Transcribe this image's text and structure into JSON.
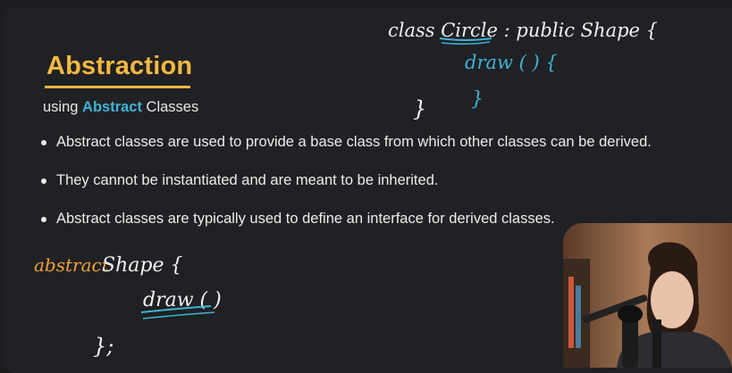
{
  "slide": {
    "title": "Abstraction",
    "subtitle_prefix": "using ",
    "subtitle_accent": "Abstract",
    "subtitle_suffix": " Classes",
    "bullets": [
      "Abstract classes are used to provide a base class from which other classes can be derived.",
      "They cannot be instantiated and are meant to be inherited.",
      "Abstract classes are typically used to define an interface for derived classes."
    ]
  },
  "annotations": {
    "top_line1": "class Circle : public Shape {",
    "top_line2": "draw ( ) {",
    "top_brace_inner": "}",
    "top_brace_outer": "}",
    "bottom_keyword": "abstract",
    "bottom_class": "Shape {",
    "bottom_method": "draw ( )",
    "bottom_close": "};"
  },
  "colors": {
    "title": "#f4b942",
    "accent": "#3fb3d8",
    "ink_white": "#f2f2f2",
    "ink_orange": "#f0a23a",
    "ink_blue": "#3fb3d8"
  }
}
